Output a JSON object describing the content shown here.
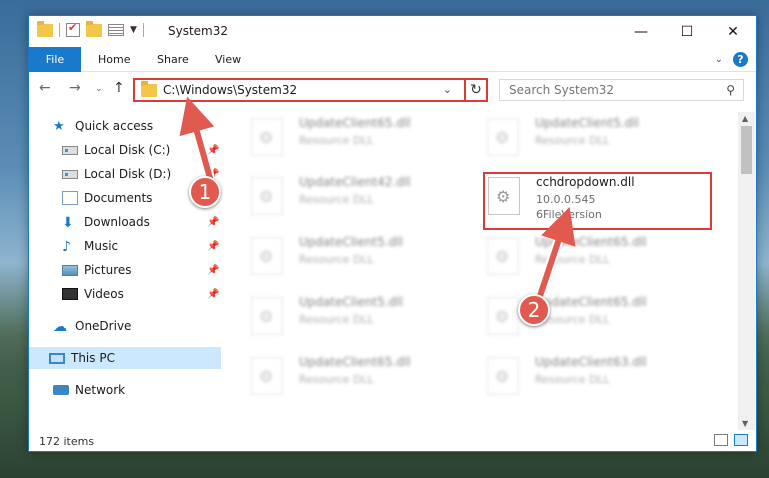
{
  "window": {
    "title": "System32",
    "minimize": "—",
    "maximize": "☐",
    "close": "✕"
  },
  "ribbon": {
    "file": "File",
    "home": "Home",
    "share": "Share",
    "view": "View"
  },
  "address": {
    "path": "C:\\Windows\\System32",
    "search_placeholder": "Search System32"
  },
  "sidebar": {
    "items": [
      {
        "label": "Quick access",
        "icon": "star-icon"
      },
      {
        "label": "Local Disk (C:)",
        "icon": "disk-icon",
        "pinned": true
      },
      {
        "label": "Local Disk (D:)",
        "icon": "disk-icon",
        "pinned": true
      },
      {
        "label": "Documents",
        "icon": "documents-icon",
        "pinned": true
      },
      {
        "label": "Downloads",
        "icon": "download-icon",
        "pinned": true
      },
      {
        "label": "Music",
        "icon": "music-icon",
        "pinned": true
      },
      {
        "label": "Pictures",
        "icon": "pictures-icon",
        "pinned": true
      },
      {
        "label": "Videos",
        "icon": "videos-icon",
        "pinned": true
      },
      {
        "label": "OneDrive",
        "icon": "cloud-icon"
      },
      {
        "label": "This PC",
        "icon": "pc-icon",
        "selected": true
      },
      {
        "label": "Network",
        "icon": "network-icon"
      }
    ]
  },
  "files": {
    "left": [
      {
        "name": "UpdateClient65.dll",
        "type": "Resource DLL"
      },
      {
        "name": "UpdateClient42.dll",
        "type": "Resource DLL"
      },
      {
        "name": "UpdateClient5.dll",
        "type": "Resource DLL"
      },
      {
        "name": "UpdateClient5.dll",
        "type": "Resource DLL"
      },
      {
        "name": "UpdateClient65.dll",
        "type": "Resource DLL"
      }
    ],
    "right": [
      {
        "name": "UpdateClient5.dll",
        "type": "Resource DLL"
      },
      {
        "name": "UpdateClient65.dll",
        "type": "Resource DLL"
      },
      {
        "name": "UpdateClient65.dll",
        "type": "Resource DLL"
      },
      {
        "name": "UpdateClient63.dll",
        "type": "Resource DLL"
      }
    ],
    "highlighted": {
      "name": "cchdropdown.dll",
      "version": "10.0.0.545",
      "description": "6FileVersion"
    }
  },
  "status": {
    "item_count": "172 items"
  },
  "annotations": {
    "step1": "1",
    "step2": "2",
    "color": "#e05a4f"
  }
}
